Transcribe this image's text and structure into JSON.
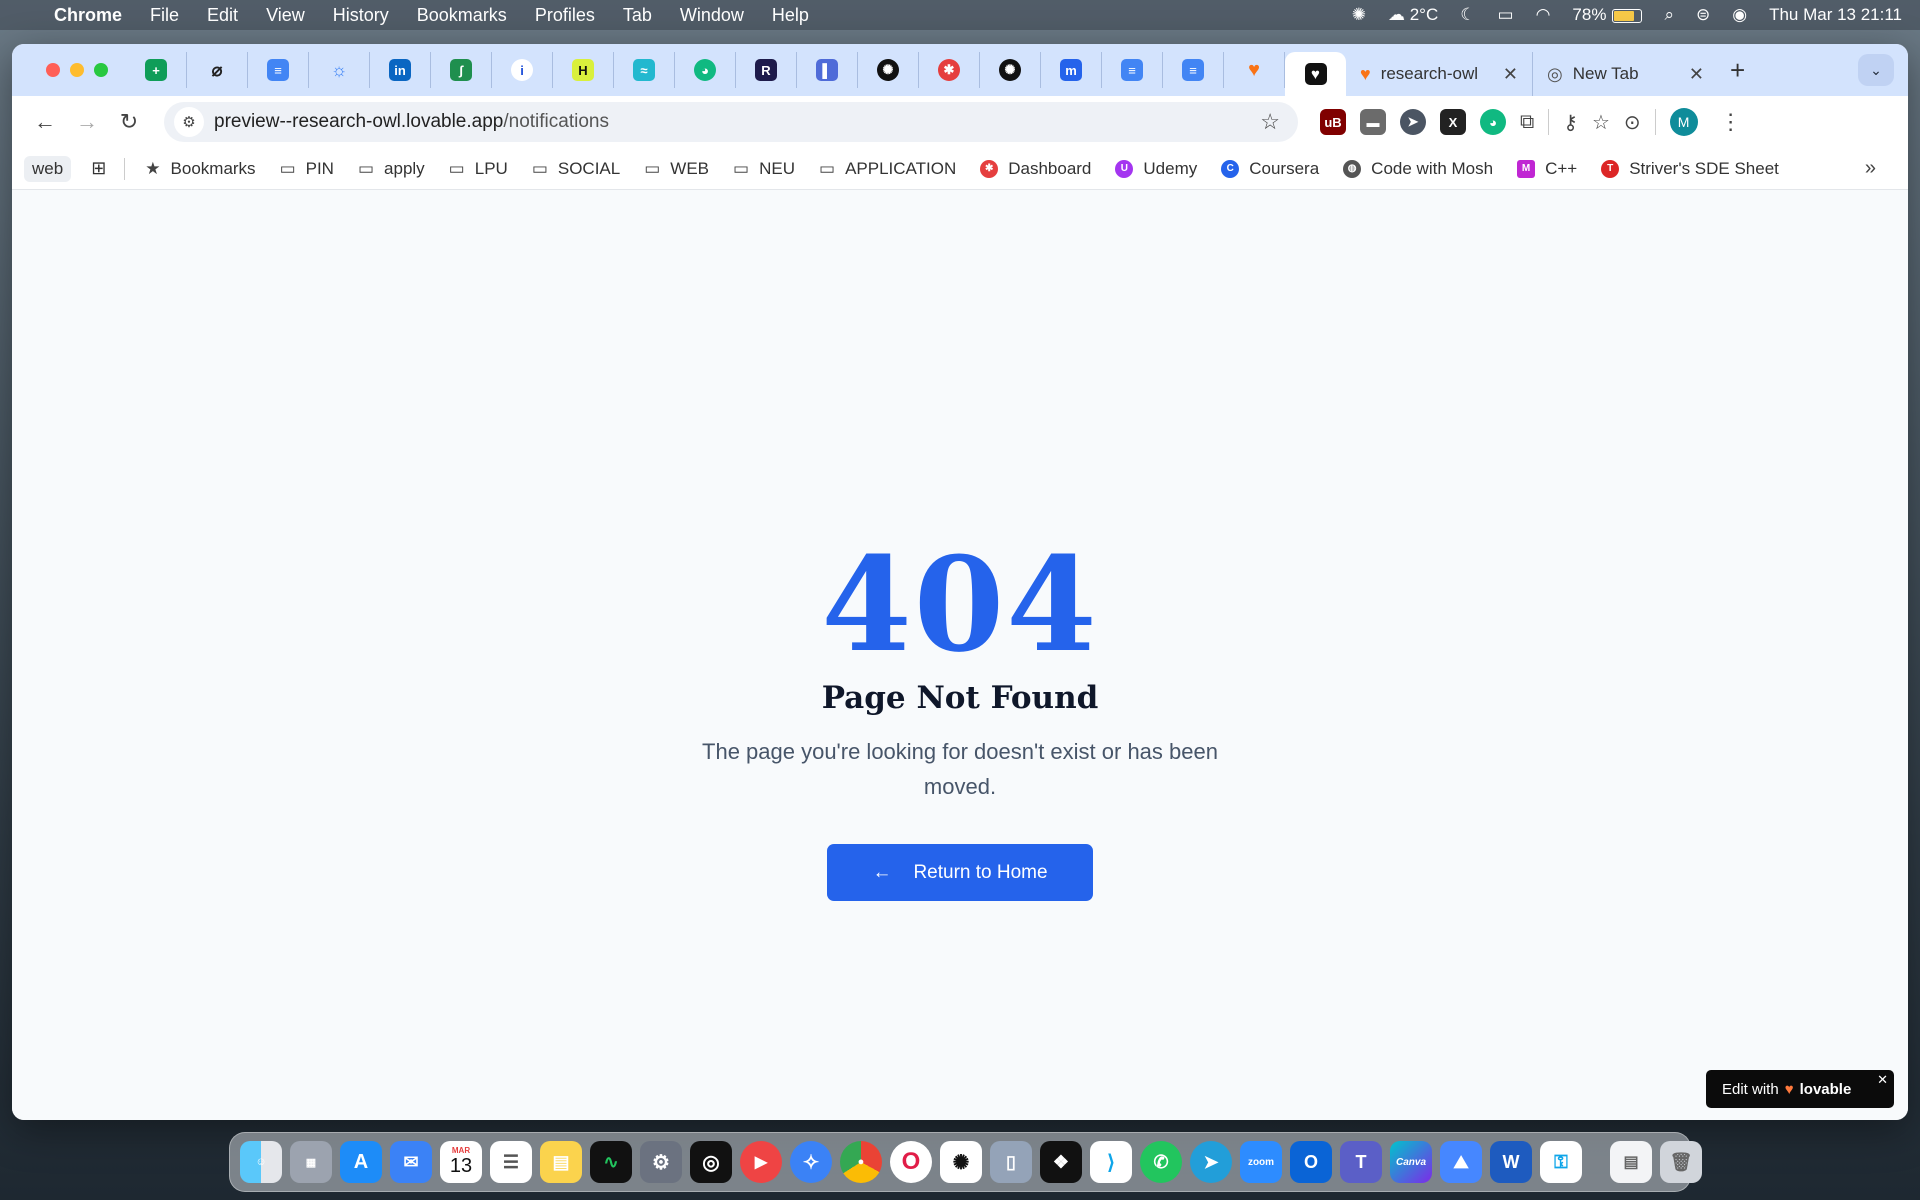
{
  "menubar": {
    "app": "Chrome",
    "menus": [
      "File",
      "Edit",
      "View",
      "History",
      "Bookmarks",
      "Profiles",
      "Tab",
      "Window",
      "Help"
    ],
    "weather": "2°C",
    "battery": "78%",
    "battery_level": 0.78,
    "datetime": "Thu Mar 13  21:11"
  },
  "tabs": {
    "pinned_icons": [
      "sheets-icon",
      "slash-circle-icon",
      "docs-icon",
      "sun-icon",
      "linkedin-icon",
      "green-app-icon",
      "info-icon",
      "hyper-icon",
      "stack-icon",
      "chatbot-icon",
      "r-app-icon",
      "book-icon",
      "openai-icon",
      "target-icon",
      "openai-icon",
      "meetup-icon",
      "docs-icon",
      "docs-icon",
      "lovable-heart-icon",
      "active-heart-icon"
    ],
    "research_tab_label": "research-owl",
    "newtab_label": "New Tab"
  },
  "toolbar": {
    "url_host": "preview--research-owl.lovable.app",
    "url_path": "/notifications",
    "avatar_letter": "M"
  },
  "bookmarks": {
    "web": "web",
    "items": [
      {
        "label": "Bookmarks",
        "icon": "star-icon"
      },
      {
        "label": "PIN",
        "icon": "folder-icon"
      },
      {
        "label": "apply",
        "icon": "folder-icon"
      },
      {
        "label": "LPU",
        "icon": "folder-icon"
      },
      {
        "label": "SOCIAL",
        "icon": "folder-icon"
      },
      {
        "label": "WEB",
        "icon": "folder-icon"
      },
      {
        "label": "NEU",
        "icon": "folder-icon"
      },
      {
        "label": "APPLICATION",
        "icon": "folder-icon"
      },
      {
        "label": "Dashboard",
        "icon": "dashboard-icon"
      },
      {
        "label": "Udemy",
        "icon": "udemy-icon"
      },
      {
        "label": "Coursera",
        "icon": "coursera-icon"
      },
      {
        "label": "Code with Mosh",
        "icon": "globe-icon"
      },
      {
        "label": "C++",
        "icon": "cpp-icon"
      },
      {
        "label": "Striver's SDE Sheet",
        "icon": "tuf-icon"
      }
    ]
  },
  "page": {
    "code": "404",
    "title": "Page Not Found",
    "message": "The page you're looking for doesn't exist or has been moved.",
    "button_label": "Return to Home"
  },
  "badge": {
    "prefix": "Edit with",
    "brand": "lovable"
  },
  "dock": {
    "calendar_month": "MAR",
    "calendar_day": "13",
    "zoom_label": "zoom",
    "canva_label": "Canva",
    "apps": [
      "finder-icon",
      "launchpad-icon",
      "appstore-icon",
      "mail-icon",
      "calendar-icon",
      "reminders-icon",
      "notes-icon",
      "activity-monitor-icon",
      "settings-icon",
      "focus-icon",
      "youtube-music-icon",
      "safari-icon",
      "chrome-icon",
      "opera-icon",
      "chatgpt-icon",
      "iphone-mirroring-icon",
      "figma-icon",
      "vscode-icon",
      "whatsapp-icon",
      "telegram-icon",
      "zoom-icon",
      "outlook-icon",
      "teams-icon",
      "canva-icon",
      "nordvpn-icon",
      "word-icon",
      "keychain-icon",
      "document-icon",
      "trash-icon"
    ]
  }
}
